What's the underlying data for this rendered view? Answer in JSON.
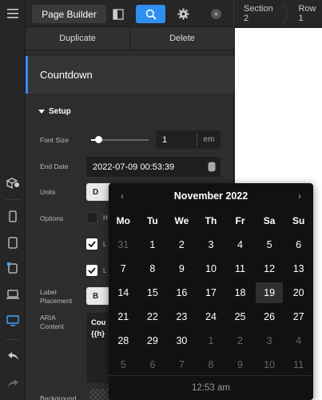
{
  "topbar": {
    "page_builder_label": "Page Builder",
    "breadcrumbs": [
      "Section 2",
      "Row 1"
    ]
  },
  "actions": {
    "duplicate": "Duplicate",
    "delete": "Delete"
  },
  "panel": {
    "title": "Countdown",
    "section": "Setup",
    "font_size": {
      "label": "Font Size",
      "value": "1",
      "unit": "em",
      "slider_level": 0.12
    },
    "end_date": {
      "label": "End Date",
      "value": "2022-07-09 00:53:39"
    },
    "units": {
      "label": "Units",
      "selected": "D"
    },
    "options": {
      "label": "Options",
      "items": [
        {
          "text": "H",
          "checked": false
        },
        {
          "text": "L",
          "checked": true
        },
        {
          "text": "L",
          "checked": true
        }
      ]
    },
    "label_placement": {
      "label": "Label Placement",
      "selected": "B"
    },
    "aria_content": {
      "label": "ARIA Content",
      "value_line1": "Cou",
      "value_line2": "{{h}"
    },
    "background": {
      "label": "Background"
    }
  },
  "picker": {
    "month_label": "November 2022",
    "weekdays": [
      "Mo",
      "Tu",
      "We",
      "Th",
      "Fr",
      "Sa",
      "Su"
    ],
    "weeks": [
      [
        {
          "d": "31",
          "m": true
        },
        {
          "d": "1"
        },
        {
          "d": "2"
        },
        {
          "d": "3"
        },
        {
          "d": "4"
        },
        {
          "d": "5"
        },
        {
          "d": "6"
        }
      ],
      [
        {
          "d": "7"
        },
        {
          "d": "8"
        },
        {
          "d": "9"
        },
        {
          "d": "10"
        },
        {
          "d": "11"
        },
        {
          "d": "12"
        },
        {
          "d": "13"
        }
      ],
      [
        {
          "d": "14"
        },
        {
          "d": "15"
        },
        {
          "d": "16"
        },
        {
          "d": "17"
        },
        {
          "d": "18"
        },
        {
          "d": "19",
          "s": true
        },
        {
          "d": "20"
        }
      ],
      [
        {
          "d": "21"
        },
        {
          "d": "22"
        },
        {
          "d": "23"
        },
        {
          "d": "24"
        },
        {
          "d": "25"
        },
        {
          "d": "26"
        },
        {
          "d": "27"
        }
      ],
      [
        {
          "d": "28"
        },
        {
          "d": "29"
        },
        {
          "d": "30"
        },
        {
          "d": "1",
          "m": true
        },
        {
          "d": "2",
          "m": true
        },
        {
          "d": "3",
          "m": true
        },
        {
          "d": "4",
          "m": true
        }
      ],
      [
        {
          "d": "5",
          "m": true
        },
        {
          "d": "6",
          "m": true
        },
        {
          "d": "7",
          "m": true
        },
        {
          "d": "8",
          "m": true
        },
        {
          "d": "9",
          "m": true
        },
        {
          "d": "10",
          "m": true
        },
        {
          "d": "11",
          "m": true
        }
      ]
    ],
    "time": "12:53 am"
  },
  "colors": {
    "accent": "#2f8ff0",
    "panel": "#2d2d2d",
    "picker_bg": "#111111"
  },
  "icons": {
    "rail": [
      "menu-icon",
      "shapes-add-icon",
      "phone-icon",
      "tablet-icon",
      "tablet-rotate-icon",
      "laptop-icon",
      "desktop-icon",
      "undo-icon",
      "redo-icon"
    ],
    "topbar": [
      "layout-panel-icon",
      "search-icon",
      "gear-icon",
      "plugin-icon"
    ]
  }
}
